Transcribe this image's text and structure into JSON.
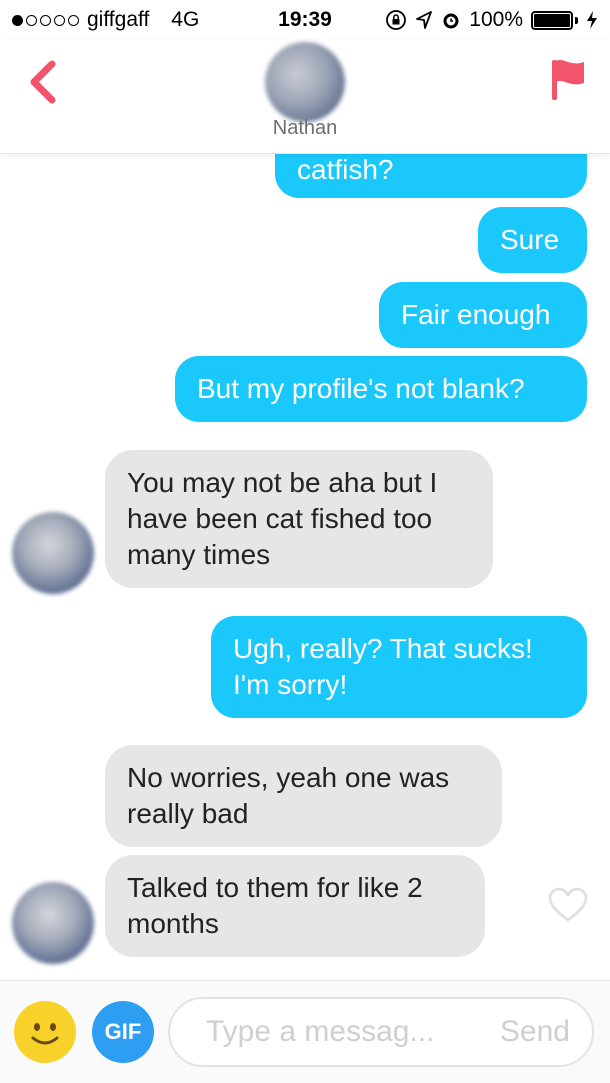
{
  "status_bar": {
    "carrier": "giffgaff",
    "network": "4G",
    "time": "19:39",
    "battery": "100%",
    "battery_level": 1.0,
    "signal_bars_filled": 1,
    "signal_bars_total": 5
  },
  "header": {
    "contact_name": "Nathan",
    "accent_color": "#f2556b"
  },
  "messages": [
    {
      "direction": "outgoing",
      "text": "catfish?"
    },
    {
      "direction": "outgoing",
      "text": "Sure"
    },
    {
      "direction": "outgoing",
      "text": "Fair enough"
    },
    {
      "direction": "outgoing",
      "text": "But my profile's not blank?"
    },
    {
      "direction": "incoming",
      "text": "You may not be aha but I have been cat fished too many times"
    },
    {
      "direction": "outgoing",
      "text": "Ugh, really? That sucks! I'm sorry!"
    },
    {
      "direction": "incoming",
      "text": "No worries, yeah one was really bad"
    },
    {
      "direction": "incoming",
      "text": "Talked to them for like 2 months"
    }
  ],
  "composer": {
    "gif_label": "GIF",
    "placeholder": "Type a messag...",
    "send_label": "Send"
  },
  "colors": {
    "outgoing_bubble": "#1ac8fc",
    "incoming_bubble": "#e6e6e6",
    "gif_button": "#2e9ef3",
    "emoji_button": "#f8d12a"
  },
  "icons": [
    "back-chevron-icon",
    "report-flag-icon",
    "heart-icon",
    "smiley-icon",
    "lock-rotation-icon",
    "location-arrow-icon",
    "alarm-icon",
    "charging-bolt-icon"
  ]
}
